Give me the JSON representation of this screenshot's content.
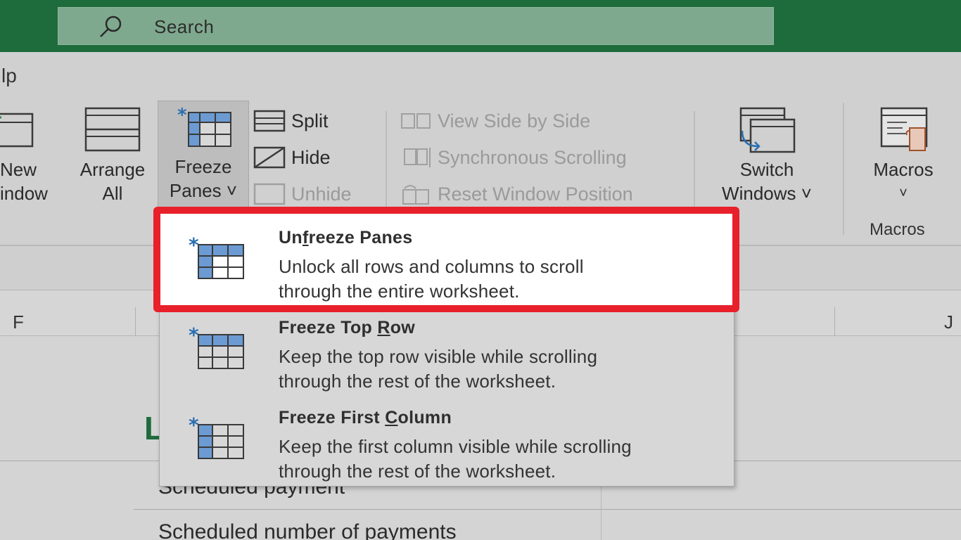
{
  "search": {
    "placeholder": "Search",
    "icon": "search-icon"
  },
  "tabs": {
    "partial_tab": "lp"
  },
  "ribbon": {
    "new_window": {
      "line1": "New",
      "line2": "indow"
    },
    "arrange_all": {
      "line1": "Arrange",
      "line2": "All"
    },
    "freeze_panes": {
      "line1": "Freeze",
      "line2": "Panes ˅"
    },
    "split": "Split",
    "hide": "Hide",
    "unhide": "Unhide",
    "view_side_by_side": "View Side by Side",
    "synchronous_scrolling": "Synchronous Scrolling",
    "reset_window_position": "Reset Window Position",
    "switch_windows": {
      "line1": "Switch",
      "line2": "Windows ˅"
    },
    "macros": {
      "line1": "Macros",
      "line2": "˅",
      "group_label": "Macros"
    }
  },
  "columns": {
    "f": "F",
    "j": "J"
  },
  "cells": {
    "big_letter": "L",
    "row1": "Scheduled payment",
    "row2": "Scheduled number of payments"
  },
  "freeze_menu": {
    "items": [
      {
        "title_pre": "Un",
        "title_u": "f",
        "title_post": "reeze Panes",
        "desc_line1": "Unlock all rows and columns to scroll",
        "desc_line2": "through the entire worksheet."
      },
      {
        "title_pre": "Freeze Top ",
        "title_u": "R",
        "title_post": "ow",
        "desc_line1": "Keep the top row visible while scrolling",
        "desc_line2": "through the rest of the worksheet."
      },
      {
        "title_pre": "Freeze First ",
        "title_u": "C",
        "title_post": "olumn",
        "desc_line1": "Keep the first column visible while scrolling",
        "desc_line2": "through the rest of the worksheet."
      }
    ]
  },
  "colors": {
    "titlebar": "#1e6b3c",
    "highlight": "#e8202a",
    "grid_blue": "#6b9bd2"
  }
}
